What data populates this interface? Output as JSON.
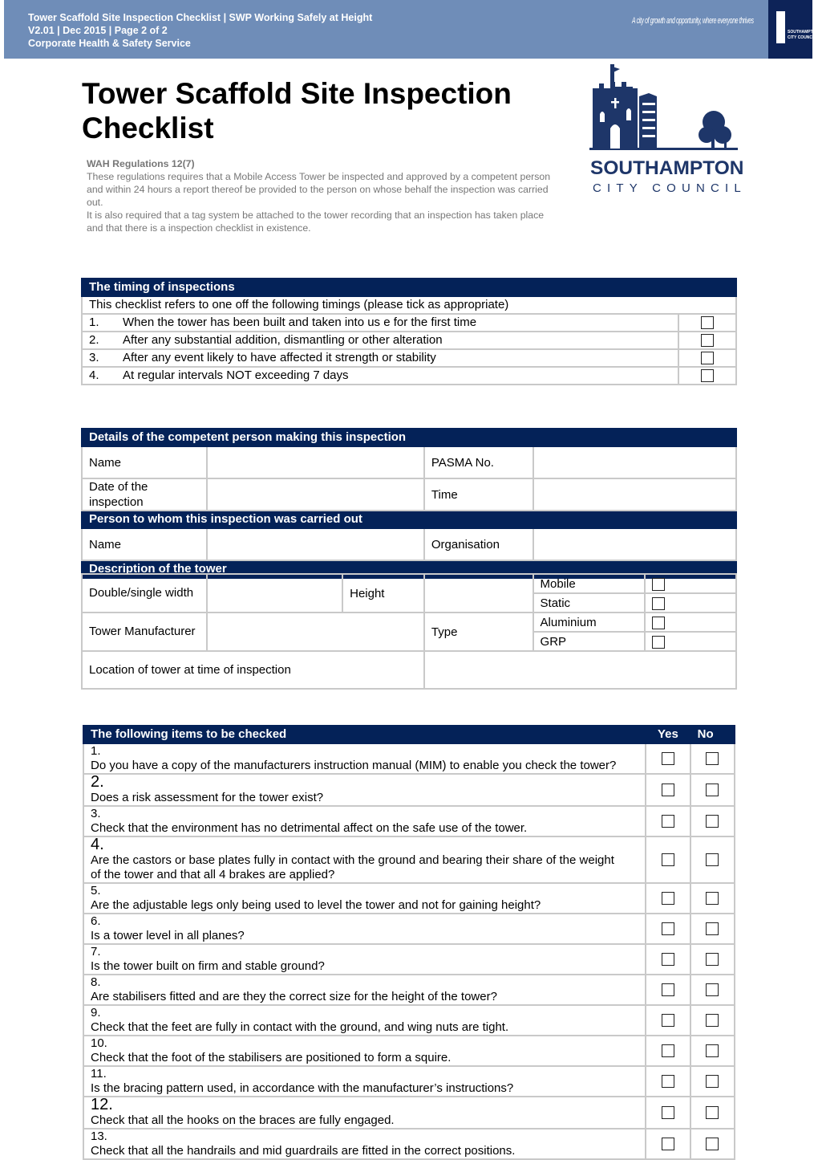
{
  "header": {
    "line1": "Tower Scaffold Site Inspection Checklist | SWP Working Safely at Height",
    "line2": "V2.01 | Dec 2015 | Page 2 of 2",
    "line3": "Corporate Health & Safety Service",
    "tagline": "A city of growth and opportunity, where everyone thrives",
    "badge_text": "SOUTHAMPTON CITY COUNCIL",
    "banner_color": "#6f8db8",
    "brand_color": "#042258"
  },
  "title": "Tower Scaffold Site Inspection Checklist",
  "intro": {
    "heading": "WAH Regulations 12(7)",
    "para1": "These regulations requires that a Mobile Access Tower be inspected and approved by a competent person and within 24 hours a report thereof be provided to the person on whose behalf the inspection was carried out.",
    "para2": "It is also required that a tag system be attached to the tower recording that an inspection has taken place and that there is a inspection checklist in existence."
  },
  "logo": {
    "name": "SOUTHAMPTON",
    "sub": "CITY COUNCIL"
  },
  "timing": {
    "heading": "The timing of inspections",
    "subheading": "This checklist refers to one off the following timings (please tick as appropriate)",
    "items": [
      {
        "num": "1.",
        "text": "When the tower has been built and taken into us e for the first time"
      },
      {
        "num": "2.",
        "text": "After any substantial addition, dismantling or other alteration"
      },
      {
        "num": "3.",
        "text": "After any event likely to have affected it strength or stability"
      },
      {
        "num": "4.",
        "text": "At regular intervals NOT exceeding 7 days"
      }
    ]
  },
  "details": {
    "heading": "Details of the competent person making this inspection",
    "name_label": "Name",
    "pasma_label": "PASMA No.",
    "date_label": "Date of the inspection",
    "time_label": "Time",
    "person_heading": "Person to whom  this inspection was carried out",
    "person_name_label": "Name",
    "organisation_label": "Organisation",
    "tower_heading": "Description of the tower",
    "width_label": "Double/single width",
    "height_label": "Height",
    "mobile_label": "Mobile",
    "static_label": "Static",
    "manufacturer_label": "Tower Manufacturer",
    "type_label": "Type",
    "aluminium_label": "Aluminium",
    "grp_label": "GRP",
    "location_label": "Location of tower at time of inspection"
  },
  "checks": {
    "heading": "The following items to be checked",
    "yes_label": "Yes",
    "no_label": "No",
    "items": [
      {
        "num": "1.",
        "text": "Do you have a copy of the manufacturers instruction manual (MIM) to enable you check the tower?"
      },
      {
        "num": "2.",
        "text": "Does a risk assessment for the tower exist?"
      },
      {
        "num": "3.",
        "text": "Check that the environment has no detrimental affect on the safe use of the tower."
      },
      {
        "num": "4.",
        "text": "Are the castors or base plates fully in contact with the ground and bearing their share of the weight of the tower and that all 4 brakes are applied?"
      },
      {
        "num": "5.",
        "text": "Are the adjustable legs only being used to level the tower and not for gaining height?"
      },
      {
        "num": "6.",
        "text": "Is a tower level in all planes?"
      },
      {
        "num": "7.",
        "text": "Is the tower built on firm and stable ground?"
      },
      {
        "num": "8.",
        "text": "Are stabilisers fitted and are they the correct size for the height of the tower?"
      },
      {
        "num": "9.",
        "text": "Check that the feet are fully in contact with the ground, and wing nuts are tight."
      },
      {
        "num": "10.",
        "text": "Check that the foot of the stabilisers are positioned to form a squire."
      },
      {
        "num": "11.",
        "text": "Is the bracing pattern used, in accordance with the manufacturer’s instructions?"
      },
      {
        "num": "12.",
        "text": "Check that all the hooks on the braces are fully engaged."
      },
      {
        "num": "13.",
        "text": "Check that all the handrails and mid guardrails are fitted in the correct positions."
      }
    ]
  }
}
